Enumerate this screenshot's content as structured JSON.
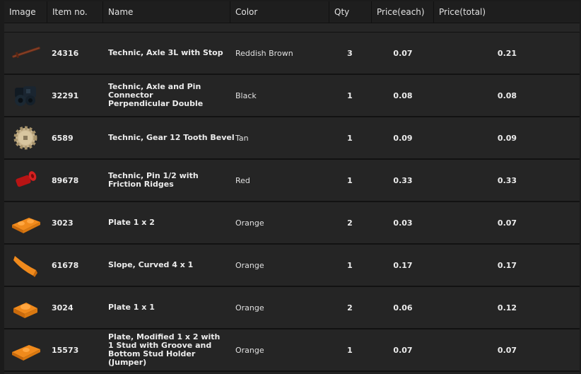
{
  "columns": {
    "image": "Image",
    "item_no": "Item no.",
    "name": "Name",
    "color": "Color",
    "qty": "Qty",
    "price_each": "Price(each)",
    "price_total": "Price(total)"
  },
  "rows": [
    {
      "icon": "axle-stop-icon",
      "item_no": "24316",
      "name": "Technic, Axle  3L with Stop",
      "color": "Reddish Brown",
      "qty": "3",
      "price_each": "0.07",
      "price_total": "0.21"
    },
    {
      "icon": "axle-pin-connector-icon",
      "item_no": "32291",
      "name": "Technic, Axle and Pin Connector Perpendicular Double",
      "color": "Black",
      "qty": "1",
      "price_each": "0.08",
      "price_total": "0.08"
    },
    {
      "icon": "bevel-gear-icon",
      "item_no": "6589",
      "name": "Technic, Gear 12 Tooth Bevel",
      "color": "Tan",
      "qty": "1",
      "price_each": "0.09",
      "price_total": "0.09"
    },
    {
      "icon": "friction-pin-icon",
      "item_no": "89678",
      "name": "Technic, Pin 1/2 with Friction Ridges",
      "color": "Red",
      "qty": "1",
      "price_each": "0.33",
      "price_total": "0.33"
    },
    {
      "icon": "plate-1x2-icon",
      "item_no": "3023",
      "name": "Plate 1 x 2",
      "color": "Orange",
      "qty": "2",
      "price_each": "0.03",
      "price_total": "0.07"
    },
    {
      "icon": "curved-slope-icon",
      "item_no": "61678",
      "name": "Slope, Curved 4 x 1",
      "color": "Orange",
      "qty": "1",
      "price_each": "0.17",
      "price_total": "0.17"
    },
    {
      "icon": "plate-1x1-icon",
      "item_no": "3024",
      "name": "Plate 1 x 1",
      "color": "Orange",
      "qty": "2",
      "price_each": "0.06",
      "price_total": "0.12"
    },
    {
      "icon": "jumper-plate-icon",
      "item_no": "15573",
      "name": "Plate, Modified 1 x 2 with 1 Stud with Groove and Bottom Stud Holder (Jumper)",
      "color": "Orange",
      "qty": "1",
      "price_each": "0.07",
      "price_total": "0.07"
    }
  ]
}
